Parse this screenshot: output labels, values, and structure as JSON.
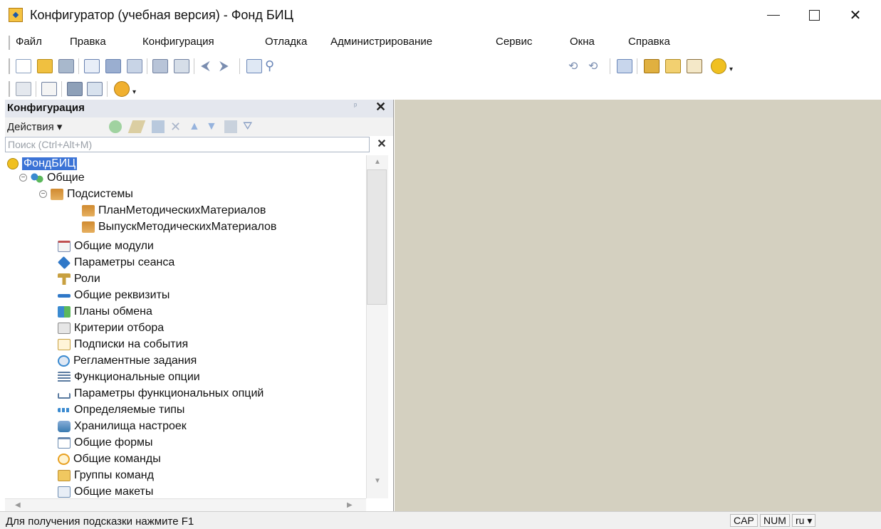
{
  "window": {
    "title": "Конфигуратор (учебная версия) - Фонд БИЦ",
    "min_glyph": "",
    "max_glyph": "",
    "close_glyph": "✕"
  },
  "menu": {
    "items": [
      "Файл",
      "Правка",
      "Конфигурация",
      "Отладка",
      "Администрирование",
      "Сервис",
      "Окна",
      "Справка"
    ]
  },
  "toolbar": {
    "search_value": "",
    "icons_row1": [
      "new-document-icon",
      "open-icon",
      "save-icon",
      "cut-icon",
      "copy-icon",
      "paste-icon",
      "print-icon",
      "print-preview-icon",
      "undo-icon",
      "redo-icon",
      "find-icon",
      "search-icon",
      "find-next-icon",
      "find-prev-icon",
      "windows-icon",
      "wizard-icon",
      "query-icon",
      "text-icon",
      "info-icon"
    ],
    "icons_row2": [
      "grid-icon",
      "form-icon",
      "database-icon",
      "module-icon",
      "run-icon"
    ]
  },
  "panel": {
    "title": "Конфигурация",
    "pin": "ᵖ",
    "close": "✕",
    "actions_label": "Действия ▾",
    "search_placeholder": "Поиск (Ctrl+Alt+M)",
    "search_clear": "✕"
  },
  "tree": {
    "items": [
      {
        "label": "ФондБИЦ",
        "icon": "root-config-icon",
        "color": "#f0c020"
      },
      {
        "label": "Общие",
        "icon": "common-icon",
        "color": "#4a9a3a"
      },
      {
        "label": "Подсистемы",
        "icon": "subsystems-icon",
        "color": "#d08a30"
      },
      {
        "label": "ПланМетодическихМатериалов",
        "icon": "subsystem-icon",
        "color": "#d08a30"
      },
      {
        "label": "ВыпускМетодическихМатериалов",
        "icon": "subsystem-icon",
        "color": "#d08a30"
      },
      {
        "label": "Общие модули",
        "icon": "module-icon",
        "color": "#c05050"
      },
      {
        "label": "Параметры сеанса",
        "icon": "session-params-icon",
        "color": "#2f78c8"
      },
      {
        "label": "Роли",
        "icon": "roles-icon",
        "color": "#c8a040"
      },
      {
        "label": "Общие реквизиты",
        "icon": "attributes-icon",
        "color": "#2f78c8"
      },
      {
        "label": "Планы обмена",
        "icon": "exchange-plans-icon",
        "color": "#3a8ad0"
      },
      {
        "label": "Критерии отбора",
        "icon": "filter-criteria-icon",
        "color": "#8a8a8a"
      },
      {
        "label": "Подписки на события",
        "icon": "event-subscriptions-icon",
        "color": "#e0a020"
      },
      {
        "label": "Регламентные задания",
        "icon": "scheduled-jobs-icon",
        "color": "#3a8ad0"
      },
      {
        "label": "Функциональные опции",
        "icon": "functional-options-icon",
        "color": "#5a7aa0"
      },
      {
        "label": "Параметры функциональных опций",
        "icon": "fo-params-icon",
        "color": "#5a7aa0"
      },
      {
        "label": "Определяемые типы",
        "icon": "defined-types-icon",
        "color": "#3a8ad0"
      },
      {
        "label": "Хранилища настроек",
        "icon": "settings-storage-icon",
        "color": "#3a7ab0"
      },
      {
        "label": "Общие формы",
        "icon": "forms-icon",
        "color": "#6a8ab0"
      },
      {
        "label": "Общие команды",
        "icon": "commands-icon",
        "color": "#e8a020"
      },
      {
        "label": "Группы команд",
        "icon": "command-groups-icon",
        "color": "#e0b040"
      },
      {
        "label": "Общие макеты",
        "icon": "templates-icon",
        "color": "#6a8ab0"
      }
    ]
  },
  "status": {
    "hint": "Для получения подсказки нажмите F1",
    "cap": "CAP",
    "num": "NUM",
    "lang": "ru ▾"
  },
  "colors": {
    "workarea": "#d4d0c0",
    "selection": "#3b73d6"
  }
}
